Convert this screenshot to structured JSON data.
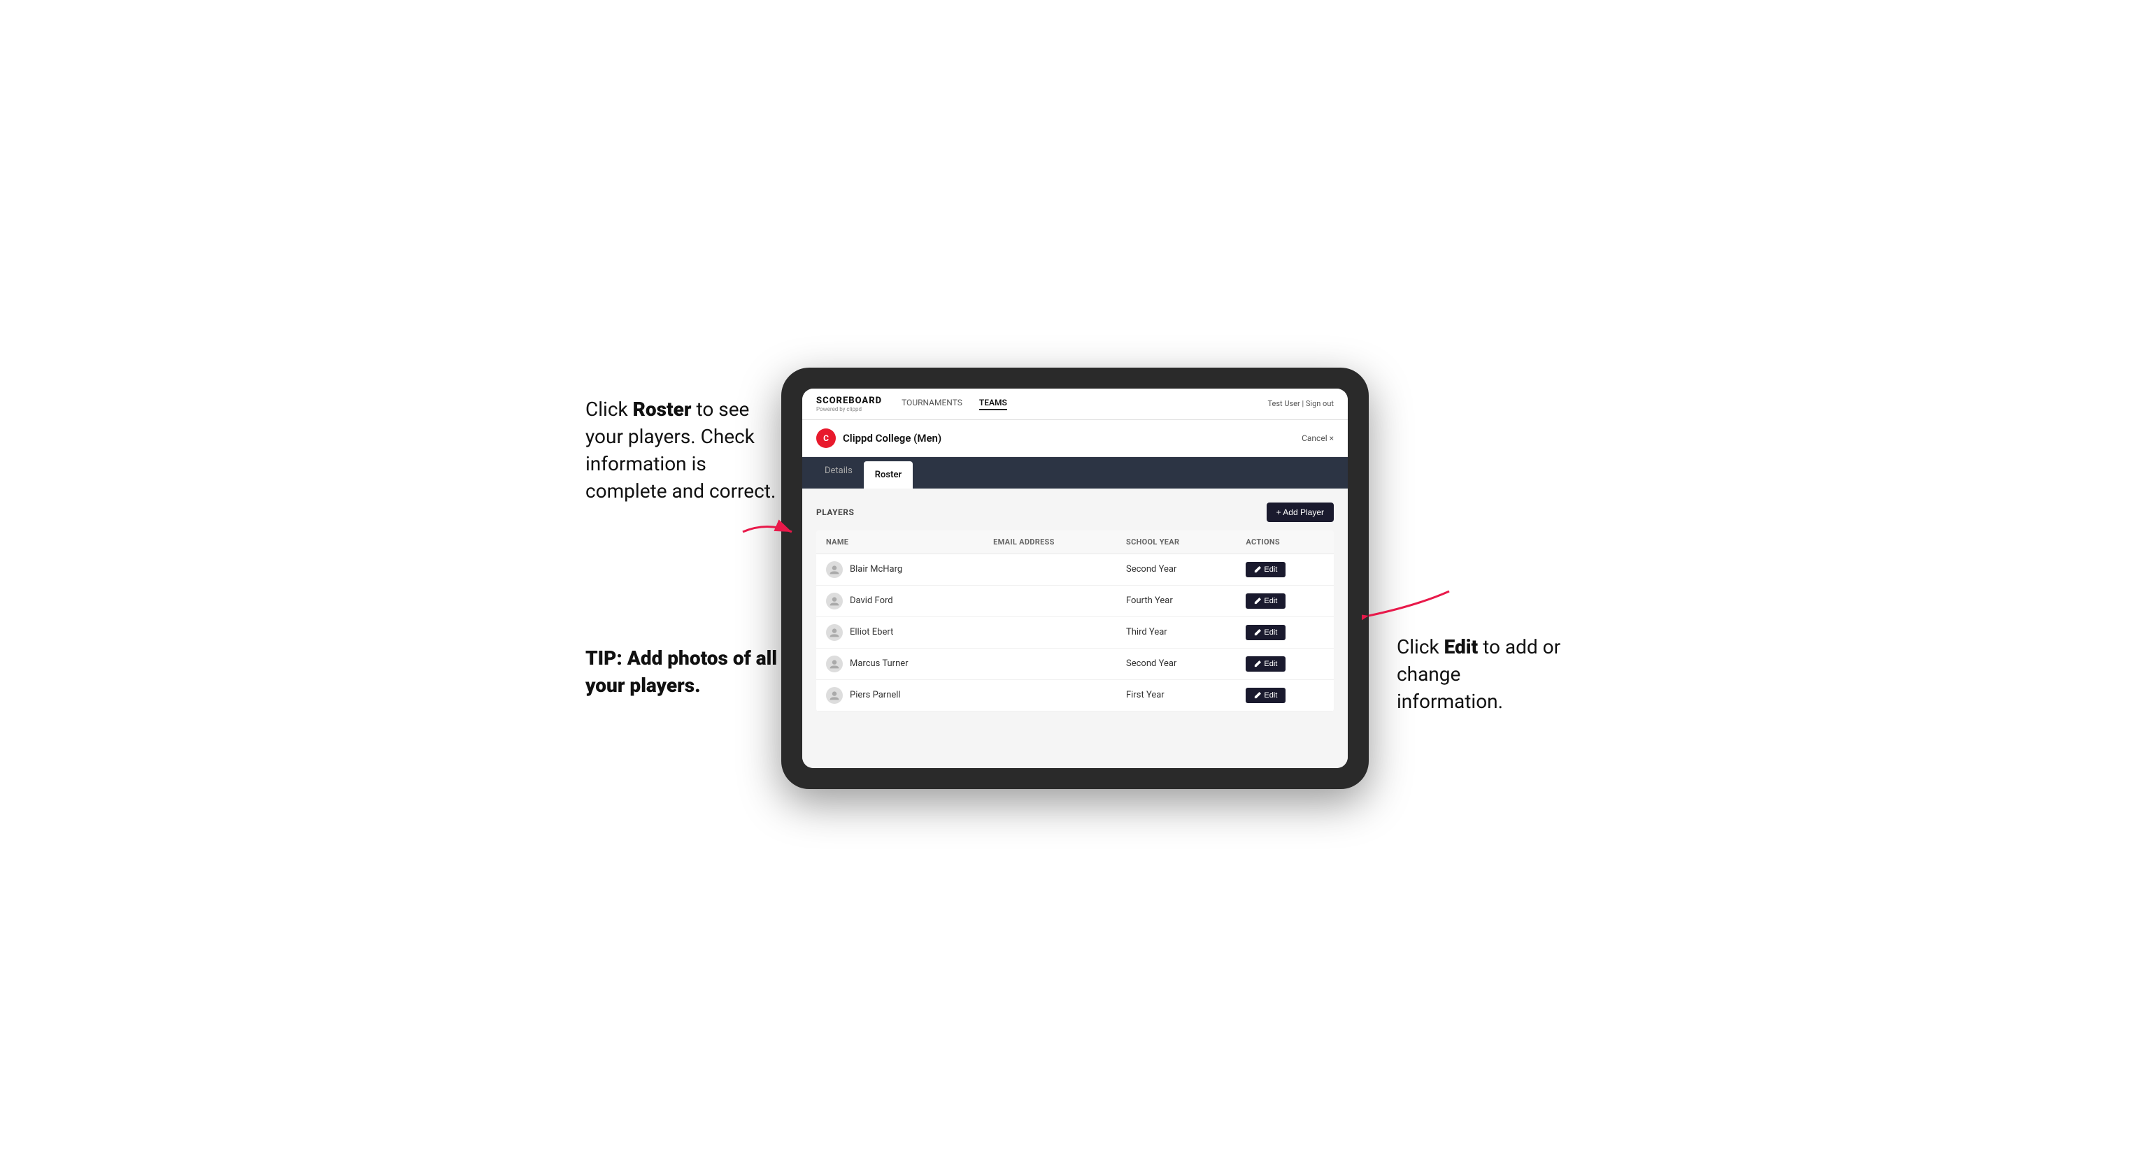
{
  "left_annotation": {
    "line1": "Click ",
    "bold1": "Roster",
    "line2": " to",
    "line3": "see your players.",
    "line4": "Check information",
    "line5": "is complete and",
    "line6": "correct.",
    "tip_label": "TIP: Add photos of",
    "tip_label2": "all your players."
  },
  "right_annotation": {
    "line1": "Click ",
    "bold1": "Edit",
    "line2": " to add or change",
    "line3": "information."
  },
  "nav": {
    "logo": "SCOREBOARD",
    "logo_sub": "Powered by clippd",
    "links": [
      "TOURNAMENTS",
      "TEAMS"
    ],
    "active_link": "TEAMS",
    "user_text": "Test User | Sign out"
  },
  "team_header": {
    "logo_letter": "C",
    "team_name": "Clippd College (Men)",
    "cancel_label": "Cancel ×"
  },
  "tabs": [
    {
      "label": "Details",
      "active": false
    },
    {
      "label": "Roster",
      "active": true
    }
  ],
  "players_section": {
    "label": "PLAYERS",
    "add_button": "+ Add Player",
    "columns": [
      "NAME",
      "EMAIL ADDRESS",
      "SCHOOL YEAR",
      "ACTIONS"
    ],
    "players": [
      {
        "name": "Blair McHarg",
        "email": "",
        "school_year": "Second Year"
      },
      {
        "name": "David Ford",
        "email": "",
        "school_year": "Fourth Year"
      },
      {
        "name": "Elliot Ebert",
        "email": "",
        "school_year": "Third Year"
      },
      {
        "name": "Marcus Turner",
        "email": "",
        "school_year": "Second Year"
      },
      {
        "name": "Piers Parnell",
        "email": "",
        "school_year": "First Year"
      }
    ],
    "edit_label": "Edit"
  }
}
